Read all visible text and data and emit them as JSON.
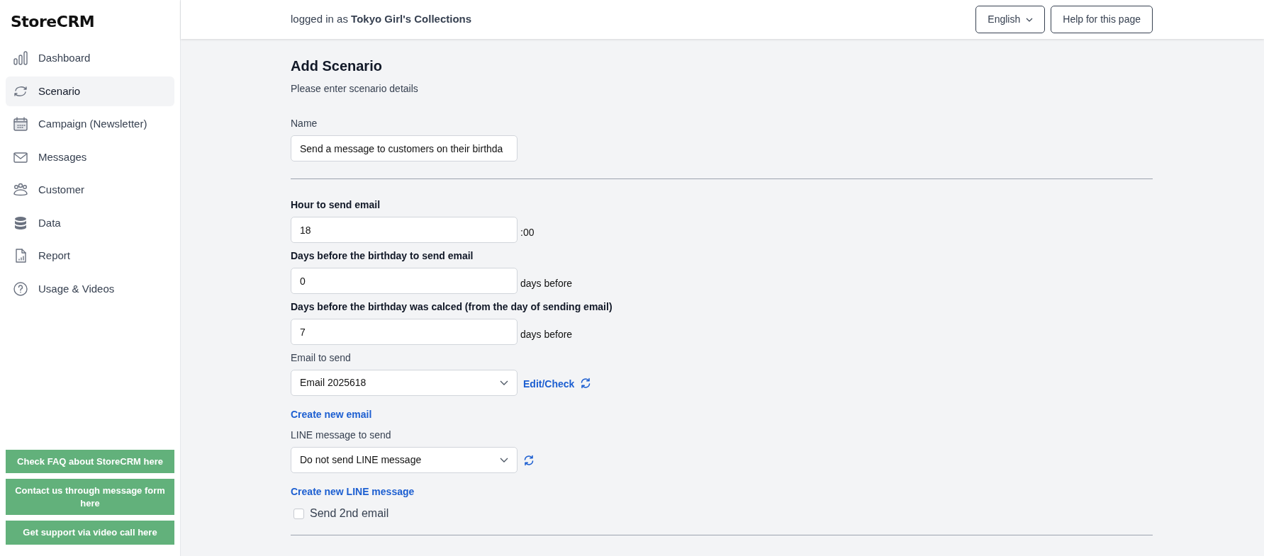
{
  "sidebar": {
    "logo": "StoreCRM",
    "items": [
      {
        "label": "Dashboard",
        "selected": false
      },
      {
        "label": "Scenario",
        "selected": true
      },
      {
        "label": "Campaign (Newsletter)",
        "selected": false
      },
      {
        "label": "Messages",
        "selected": false
      },
      {
        "label": "Customer",
        "selected": false
      },
      {
        "label": "Data",
        "selected": false
      },
      {
        "label": "Report",
        "selected": false
      },
      {
        "label": "Usage & Videos",
        "selected": false
      }
    ],
    "buttons": [
      "Check FAQ about StoreCRM here",
      "Contact us through message form here",
      "Get support via video call here"
    ]
  },
  "header": {
    "logged_in_prefix": "logged in as",
    "store_name": "Tokyo Girl's Collections",
    "language": "English",
    "help_button": "Help for this page"
  },
  "form": {
    "title": "Add Scenario",
    "subtitle": "Please enter scenario details",
    "name_field": {
      "label": "Name",
      "value": "Send a message to customers on their birthda"
    },
    "fields": [
      {
        "kind": "number",
        "label": "Hour to send email",
        "value": "18",
        "suffix": ":00"
      },
      {
        "kind": "number",
        "label": "Days before the birthday to send email",
        "value": "0",
        "suffix": "days before"
      },
      {
        "kind": "number",
        "label": "Days before the birthday was calced (from the day of sending email)",
        "value": "7",
        "suffix": "days before"
      },
      {
        "kind": "select",
        "label": "Email to send",
        "value": "Email 2025618",
        "side_link": "Edit/Check",
        "refresh": true,
        "link": "Create new email"
      },
      {
        "kind": "select",
        "label": "LINE message to send",
        "value": "Do not send LINE message",
        "refresh": true,
        "link": "Create new LINE message"
      }
    ],
    "second_email": {
      "label": "Send 2nd email",
      "checked": false
    }
  }
}
